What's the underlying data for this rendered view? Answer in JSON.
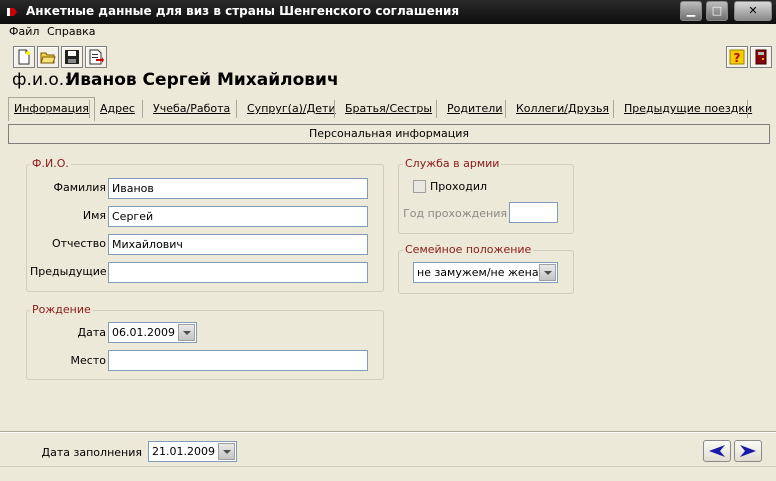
{
  "window": {
    "title": "Анкетные данные для виз в страны Шенгенского соглашения",
    "controls": [
      "minimize-icon",
      "maximize-icon",
      "close-icon"
    ],
    "close_glyph": "✕"
  },
  "menu": {
    "file": "Файл",
    "help": "Справка"
  },
  "toolbar": {
    "buttons": [
      "new-document-icon",
      "open-folder-icon",
      "save-icon",
      "export-icon"
    ],
    "right_buttons": [
      "help-icon",
      "exit-icon"
    ],
    "help_glyph": "?"
  },
  "header": {
    "fio_label": "ф.и.о.:",
    "fio_value": "Иванов Сергей Михайлович"
  },
  "tabs": [
    "Информация",
    "Адрес",
    "Учеба/Работа",
    "Супруг(а)/Дети",
    "Братья/Сестры",
    "Родители",
    "Коллеги/Друзья",
    "Предыдущие поездки"
  ],
  "section_title": "Персональная информация",
  "fio_group": {
    "title": "Ф.И.О.",
    "surname_label": "Фамилия",
    "surname_value": "Иванов",
    "name_label": "Имя",
    "name_value": "Сергей",
    "patronymic_label": "Отчество",
    "patronymic_value": "Михайлович",
    "previous_label": "Предыдущие",
    "previous_value": ""
  },
  "birth_group": {
    "title": "Рождение",
    "date_label": "Дата",
    "date_value": "06.01.2009",
    "place_label": "Место",
    "place_value": ""
  },
  "army_group": {
    "title": "Служба в армии",
    "served_label": "Проходил",
    "served_checked": false,
    "year_label": "Год прохождения",
    "year_value": ""
  },
  "family_group": {
    "title": "Семейное положение",
    "status_value": "не замужем/не женат"
  },
  "footer": {
    "fill_date_label": "Дата заполнения",
    "fill_date_value": "21.01.2009"
  },
  "colors": {
    "group_title": "#8b1a1a",
    "nav_arrow": "#1a1aa8",
    "titlebar": "#111111"
  }
}
